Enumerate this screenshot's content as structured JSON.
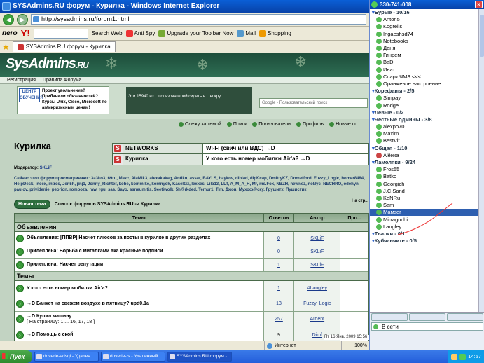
{
  "ie": {
    "title": "SYSAdmins.RU форум - Курилка - Windows Internet Explorer",
    "address": "http://sysadmins.ru/forum1.html",
    "toolbar": {
      "logo": "nero",
      "yahoo": "Y!",
      "search_web": "Search Web",
      "antispy": "Anti Spy",
      "upgrade": "Upgrade your Toolbar Now",
      "mail": "Mail",
      "shopping": "Shopping"
    },
    "tab_label": "SYSAdmins.RU форум - Курилка",
    "status": {
      "zone": "Интернет",
      "zoom": "100%"
    }
  },
  "site": {
    "logo_main": "SysAdmins",
    "logo_suffix": ".RU",
    "nav": [
      "Регистрация",
      "Правила Форума"
    ],
    "banner_logo": "ЦЕНТР ОБУЧЕНИЯ",
    "banner_text": "Проект увольнение? Прибавили обязанностей? Курсы Unix, Cisco, Microsoft по antикризисным ценам!",
    "stats_text": "Эти 15940 из... пользователей сидеть в... вокруг.",
    "google_placeholder": "Google - Пользовательский поиск",
    "links": [
      "Слежу за темой",
      "Поиск",
      "Пользователи",
      "Профиль",
      "Новые со..."
    ]
  },
  "forum": {
    "title": "Курилка",
    "quick": [
      {
        "name": "NETWORKS",
        "topic": "Wi-Fi (свич или ВДС) →D"
      },
      {
        "name": "Курилка",
        "topic": "У кого есть номер мобилки Air'a? →D"
      }
    ],
    "moderator_label": "Модератор:",
    "moderator": "SKLiF",
    "browsing": "Сейчас этот форум просматривают: 3a3ko3, 69ru, Mакс, AlaMik3, alexakakag, Antiko, assar, BAYLS, baykov, dibiad, dipKcap, DmitryKZ, Domefford, Fuzzy_Logic, homer8484, HelpDesk, incex, intrcs, Jen5h, jinj1, Jonny_Richter, kobe, kommike, komnyok, Kaseltzz, lexxes, Lila13, LLT, A_M_A_H, Mr, me.Fox, NBZH, newnez, noNyc, NECHRO, odehyn, paulov, prividenie, peorion, romboza, raw, rgu, sas, Sayo, ssneumitis, Seetiwolk, 5h@rkded, Temur1, Tim, Джон, Мухоф@ску, Грушитх, Пушистик",
    "new_topic": "Новая тема",
    "breadcrumb": "Список форумов SYSAdmins.RU -> Курилка",
    "na_str": "На стр...",
    "columns": {
      "themes": "Темы",
      "replies": "Ответов",
      "author": "Автор",
      "views": "Про..."
    },
    "sections": {
      "announcements": "Объявления",
      "topics": "Темы"
    },
    "announcements": [
      {
        "title": "Объявление: [ППВР] Насчет плюсов за посты в курилке в других разделах",
        "replies": "0",
        "author": "SKLiF"
      },
      {
        "title": "Прилеплена: Борьба с мигалками ака красные подписи",
        "replies": "0",
        "author": "SKLiF"
      },
      {
        "title": "Прилеплена: Насчет репутации",
        "replies": "1",
        "author": "SKLiF"
      }
    ],
    "topics": [
      {
        "title": "У кого есть номер мобилки Air'a?",
        "pages": "",
        "replies": "1",
        "author": "#Langley"
      },
      {
        "title": "→D Банкет на свежем воздухе в пятницу? upd0.1a",
        "pages": "",
        "replies": "13",
        "author": "Fuzzy_Logic"
      },
      {
        "title": "→D Купил машину",
        "pages": "[ На страницу: 1 ... 16, 17, 18 ]",
        "replies": "257",
        "author": "Ardent"
      },
      {
        "title": "→D Помощь с ской",
        "pages": "",
        "replies": "9",
        "author": "Dimf"
      }
    ],
    "post_date": "Пт 16 Янв, 2009 15:56"
  },
  "icq": {
    "title": "330-741-008",
    "groups": [
      {
        "name": "Бурые - 10/16",
        "users": [
          {
            "n": "Anton5",
            "s": "on"
          },
          {
            "n": "Kogrelis",
            "s": "on"
          },
          {
            "n": "Ingaeshsd74",
            "s": "on"
          },
          {
            "n": "Notebooks",
            "s": "on"
          },
          {
            "n": "Даня",
            "s": "on"
          },
          {
            "n": "Гинрем",
            "s": "on"
          },
          {
            "n": "ВаD",
            "s": "on"
          },
          {
            "n": "Инат",
            "s": "on"
          },
          {
            "n": "Спарк ЧМЗ <<<",
            "s": "on"
          },
          {
            "n": "Оранжевое настроение",
            "s": "on"
          }
        ]
      },
      {
        "name": "Корефаны - 2/5",
        "users": [
          {
            "n": "Simpay",
            "s": "on"
          },
          {
            "n": "Rodge",
            "s": "on"
          }
        ]
      },
      {
        "name": "Левые - 0/2",
        "users": []
      },
      {
        "name": "Честные одмины - 3/8",
        "users": [
          {
            "n": "alexpo70",
            "s": "on"
          },
          {
            "n": "Maxim",
            "s": "on"
          },
          {
            "n": "BestVit",
            "s": "on"
          }
        ]
      },
      {
        "name": "Общая - 1/10",
        "users": [
          {
            "n": "Alёнка",
            "s": "off"
          }
        ]
      },
      {
        "name": "Ламоляки - 9/24",
        "users": [
          {
            "n": "Fros55",
            "s": "on"
          },
          {
            "n": "Batko",
            "s": "on"
          },
          {
            "n": "Georgich",
            "s": "on"
          },
          {
            "n": "J.C.Sand",
            "s": "on"
          },
          {
            "n": "KeNRu",
            "s": "on"
          },
          {
            "n": "Sam",
            "s": "on"
          },
          {
            "n": "Мамзer",
            "s": "on",
            "hl": true
          },
          {
            "n": "Mirraguchi",
            "s": "on"
          },
          {
            "n": "Langley",
            "s": "on"
          }
        ]
      },
      {
        "name": "Тьалки - 0/1",
        "users": []
      },
      {
        "name": "Кубчанчитe - 0/5",
        "users": []
      }
    ],
    "status": "В сети"
  },
  "taskbar": {
    "start": "Пуск",
    "tasks": [
      "doverie-adsql - Удален...",
      "doverie-ts - Удаленный...",
      "SYSAdmins.RU форум -..."
    ],
    "clock": "14:57"
  }
}
